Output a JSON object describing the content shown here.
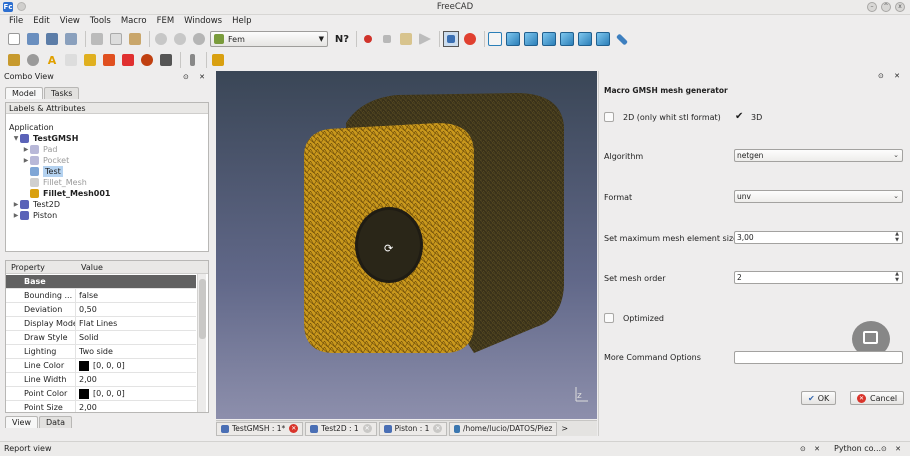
{
  "window": {
    "title": "FreeCAD"
  },
  "menu": [
    "File",
    "Edit",
    "View",
    "Tools",
    "Macro",
    "FEM",
    "Windows",
    "Help"
  ],
  "toolbar": {
    "workbench": "Fem"
  },
  "combo_view": {
    "title": "Combo View",
    "tabs": [
      "Model",
      "Tasks"
    ]
  },
  "tree": {
    "header": "Labels & Attributes",
    "root": "Application",
    "items": [
      {
        "label": "TestGMSH"
      },
      {
        "label": "Pad"
      },
      {
        "label": "Pocket"
      },
      {
        "label": "Test"
      },
      {
        "label": "Fillet_Mesh"
      },
      {
        "label": "Fillet_Mesh001"
      },
      {
        "label": "Test2D"
      },
      {
        "label": "Piston"
      }
    ]
  },
  "properties": {
    "headers": [
      "Property",
      "Value"
    ],
    "group": "Base",
    "rows": [
      {
        "name": "Bounding ...",
        "value": "false"
      },
      {
        "name": "Deviation",
        "value": "0,50"
      },
      {
        "name": "Display Mode",
        "value": "Flat Lines"
      },
      {
        "name": "Draw Style",
        "value": "Solid"
      },
      {
        "name": "Lighting",
        "value": "Two side"
      },
      {
        "name": "Line Color",
        "value": "[0, 0, 0]"
      },
      {
        "name": "Line Width",
        "value": "2,00"
      },
      {
        "name": "Point Color",
        "value": "[0, 0, 0]"
      },
      {
        "name": "Point Size",
        "value": "2,00"
      }
    ],
    "tabs": [
      "View",
      "Data"
    ]
  },
  "viewport_tabs": [
    {
      "label": "TestGMSH : 1*"
    },
    {
      "label": "Test2D : 1"
    },
    {
      "label": "Piston : 1"
    },
    {
      "label": "/home/lucio/DATOS/Piez"
    }
  ],
  "task": {
    "title": "Macro GMSH mesh generator",
    "check_2d": "2D (only whit stl format)",
    "check_3d": "3D",
    "algorithm_label": "Algorithm",
    "algorithm_value": "netgen",
    "format_label": "Format",
    "format_value": "unv",
    "max_size_label": "Set maximum mesh element size",
    "max_size_value": "3,00",
    "order_label": "Set mesh order",
    "order_value": "2",
    "optimized_label": "Optimized",
    "more_label": "More Command Options",
    "more_value": "",
    "ok": "OK",
    "cancel": "Cancel"
  },
  "status": {
    "report": "Report view",
    "python": "Python co..."
  }
}
